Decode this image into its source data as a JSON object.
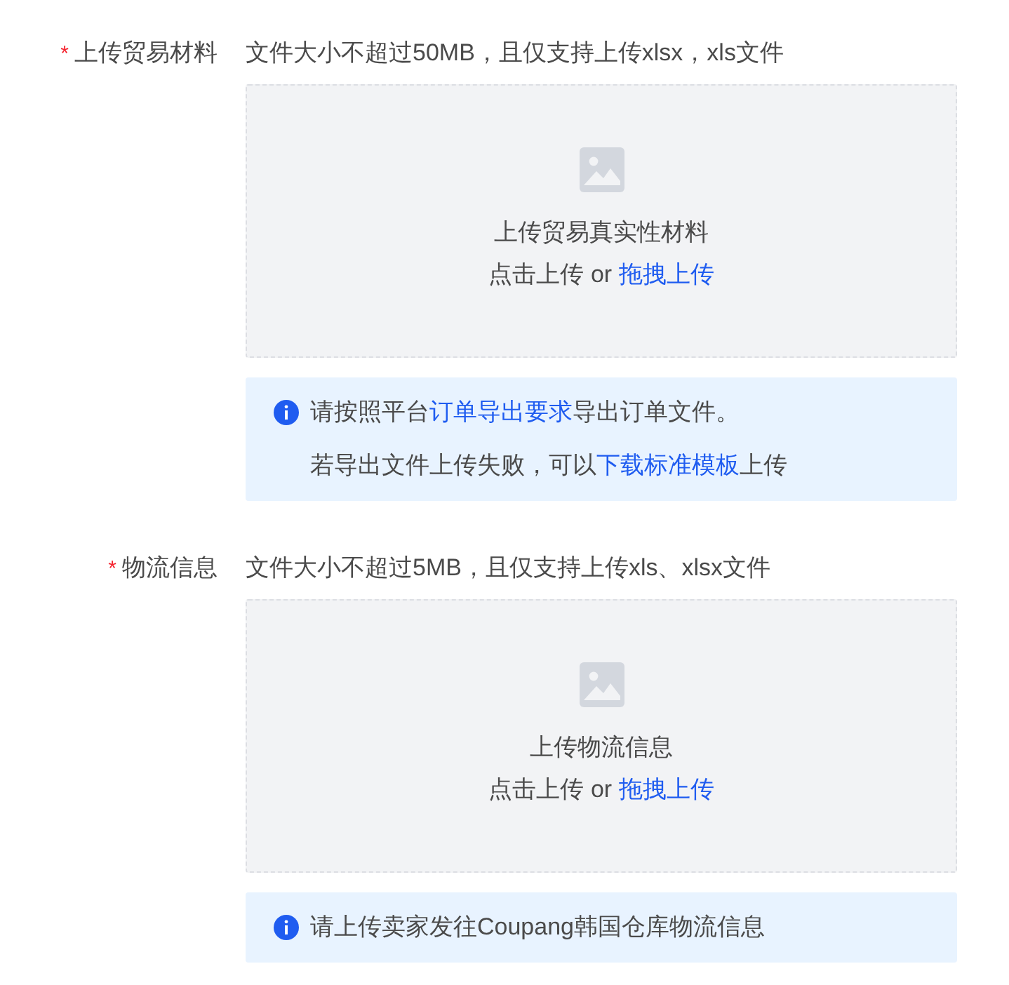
{
  "fields": [
    {
      "label": "上传贸易材料",
      "required_mark": "*",
      "hint": "文件大小不超过50MB，且仅支持上传xlsx，xls文件",
      "upload": {
        "title": "上传贸易真实性材料",
        "click_text": "点击上传 or",
        "drag_link": "拖拽上传"
      },
      "notice": {
        "lines": [
          [
            {
              "text": "请按照平台"
            },
            {
              "text": "订单导出要求",
              "link": true
            },
            {
              "text": "导出订单文件。"
            }
          ],
          [
            {
              "text": "若导出文件上传失败，可以"
            },
            {
              "text": "下载标准模板",
              "link": true
            },
            {
              "text": "上传"
            }
          ]
        ]
      }
    },
    {
      "label": "物流信息",
      "required_mark": "*",
      "hint": "文件大小不超过5MB，且仅支持上传xls、xlsx文件",
      "upload": {
        "title": "上传物流信息",
        "click_text": "点击上传 or",
        "drag_link": "拖拽上传"
      },
      "notice": {
        "lines": [
          [
            {
              "text": "请上传卖家发往Coupang韩国仓库物流信息"
            }
          ]
        ]
      }
    }
  ]
}
